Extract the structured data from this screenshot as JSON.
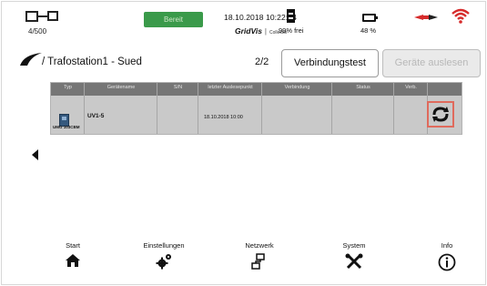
{
  "status": {
    "device_count": "4/500",
    "ready_label": "Bereit",
    "datetime": "18.10.2018 10:22:54",
    "brand": "GridVis",
    "brand_suffix": "Collector",
    "memory_free": "99% frei",
    "battery": "48 %",
    "icons": [
      "devices-icon",
      "memory-icon",
      "battery-icon",
      "network-icon",
      "wifi-icon"
    ],
    "colors": {
      "ready": "#3a9a4a",
      "alert": "#d62b2b"
    }
  },
  "header": {
    "title": "/ Trafostation1 - Sued",
    "page": "2/2",
    "test_button": "Verbindungstest",
    "disabled_button": "Geräte auslesen"
  },
  "table": {
    "columns": [
      "Typ",
      "Gerätename",
      "S/N",
      "letzter Auslesepunkt",
      "Verbindung",
      "Status",
      "Verb."
    ],
    "rows": [
      {
        "type": "UMG 103CBM",
        "name": "UV1-5",
        "sn": "",
        "last_read": "18.10.2018 10:00",
        "connection": "",
        "status": "",
        "verb": ""
      }
    ]
  },
  "nav": [
    {
      "label": "Start",
      "icon": "home-icon"
    },
    {
      "label": "Einstellungen",
      "icon": "gear-icon"
    },
    {
      "label": "Netzwerk",
      "icon": "network-icon"
    },
    {
      "label": "System",
      "icon": "tools-icon"
    },
    {
      "label": "Info",
      "icon": "info-icon"
    }
  ]
}
